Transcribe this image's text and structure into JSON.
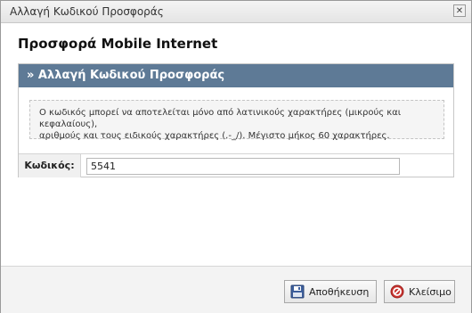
{
  "window": {
    "title": "Αλλαγή Κωδικού Προσφοράς"
  },
  "heading": "Προσφορά Mobile Internet",
  "panel": {
    "title": "» Αλλαγή Κωδικού Προσφοράς",
    "info_line1": "Ο κωδικός μπορεί να αποτελείται μόνο από λατινικούς χαρακτήρες (μικρούς και κεφαλαίους),",
    "info_line2": "αριθμούς και τους ειδικούς χαρακτήρες (.-_/). Μέγιστο μήκος 60 χαρακτήρες."
  },
  "form": {
    "code_label": "Κωδικός:",
    "code_value": "5541"
  },
  "buttons": {
    "save_label": "Αποθήκευση",
    "close_label": "Κλείσιμο"
  },
  "icons": {
    "close": "close-icon",
    "save": "floppy-disk-icon",
    "cancel": "cancel-icon"
  },
  "colors": {
    "panel_header_bg": "#5e7a96",
    "cancel_icon": "#c8332f"
  }
}
